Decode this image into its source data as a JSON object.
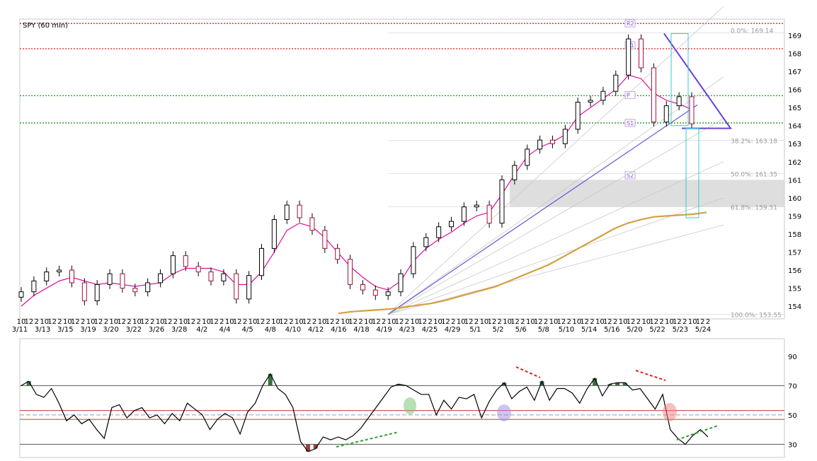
{
  "chart_data": [
    {
      "type": "candlestick",
      "title": "SPY (60 min)",
      "ylim": [
        153.3,
        169.9
      ],
      "y_ticks": [
        154,
        155,
        156,
        157,
        158,
        159,
        160,
        161,
        162,
        163,
        164,
        165,
        166,
        167,
        168,
        169
      ],
      "x_tick_labels_top": [
        "10",
        "12",
        "2",
        "10",
        "12",
        "2",
        "10",
        "12",
        "2",
        "10",
        "12",
        "2",
        "10",
        "12",
        "2",
        "10",
        "12",
        "2",
        "10",
        "12",
        "2",
        "10",
        "12",
        "2",
        "10",
        "12",
        "2",
        "10",
        "12",
        "2",
        "10",
        "12",
        "2",
        "10",
        "12",
        "2",
        "10",
        "12",
        "2",
        "10",
        "12",
        "2",
        "10",
        "12",
        "2",
        "10",
        "12",
        "2",
        "10",
        "12",
        "2",
        "10",
        "12",
        "2",
        "10",
        "12",
        "2",
        "10",
        "12",
        "2",
        "10",
        "12",
        "2",
        "10",
        "12",
        "2",
        "10",
        "12",
        "2",
        "10",
        "12",
        "2",
        "10",
        "12",
        "2",
        "10",
        "12",
        "2",
        "10",
        "12",
        "2",
        "10",
        "12",
        "2",
        "10",
        "12",
        "2",
        "10",
        "12",
        "2"
      ],
      "x_date_labels": [
        "3/11",
        "3/13",
        "3/15",
        "3/19",
        "3/20",
        "3/22",
        "3/26",
        "3/28",
        "4/2",
        "4/4",
        "4/5",
        "4/8",
        "4/10",
        "4/12",
        "4/16",
        "4/18",
        "4/19",
        "4/23",
        "4/25",
        "4/29",
        "5/1",
        "5/2",
        "5/6",
        "5/8",
        "5/10",
        "5/14",
        "5/16",
        "5/20",
        "5/22",
        "5/23",
        "5/24"
      ],
      "close_series": [
        154.8,
        155.4,
        155.9,
        156.0,
        155.3,
        154.3,
        155.2,
        155.8,
        155.0,
        154.8,
        155.3,
        155.8,
        156.8,
        156.2,
        155.9,
        155.4,
        155.8,
        154.4,
        155.7,
        157.2,
        158.8,
        159.6,
        158.9,
        158.2,
        157.2,
        156.6,
        155.2,
        154.9,
        154.6,
        154.8,
        155.8,
        157.3,
        157.8,
        158.4,
        158.7,
        159.5,
        159.6,
        158.6,
        161.0,
        161.8,
        162.7,
        163.2,
        163.0,
        163.8,
        165.3,
        165.4,
        165.9,
        166.8,
        168.8,
        167.2,
        164.2,
        165.1,
        165.6,
        164.1
      ],
      "moving_averages": [
        {
          "color": "#e0109a",
          "values": [
            154.0,
            154.6,
            155.0,
            155.4,
            155.6,
            155.4,
            155.2,
            155.3,
            155.2,
            155.1,
            155.2,
            155.3,
            155.8,
            156.1,
            156.1,
            156.1,
            155.9,
            155.2,
            155.2,
            155.9,
            157.0,
            158.2,
            158.6,
            158.4,
            157.8,
            157.0,
            156.2,
            155.6,
            155.1,
            154.9,
            155.4,
            156.5,
            157.2,
            157.7,
            158.1,
            158.6,
            159.0,
            159.2,
            160.2,
            161.3,
            162.3,
            162.8,
            163.1,
            163.5,
            164.5,
            165.0,
            165.5,
            166.0,
            166.8,
            166.6,
            165.8,
            165.4,
            165.2,
            164.9
          ]
        },
        {
          "color": "#d4a040",
          "values": [
            153.6,
            153.7,
            153.75,
            153.8,
            153.85,
            153.95,
            154.05,
            154.15,
            154.3,
            154.5,
            154.7,
            154.9,
            155.1,
            155.4,
            155.7,
            156.0,
            156.3,
            156.7,
            157.1,
            157.5,
            157.9,
            158.3,
            158.6,
            158.8,
            158.95,
            159.0,
            159.05,
            159.1,
            159.2
          ]
        }
      ],
      "horizontal_levels": [
        {
          "value": 169.66,
          "color": "#e03030"
        },
        {
          "value": 168.26,
          "color": "#e03030"
        },
        {
          "value": 165.66,
          "color": "#30a030"
        },
        {
          "value": 164.15,
          "color": "#30a030"
        }
      ],
      "pivot_labels": [
        {
          "text": "R2",
          "value": 169.66
        },
        {
          "text": "R1",
          "value": 168.45
        },
        {
          "text": "P",
          "value": 165.7
        },
        {
          "text": "S1",
          "value": 164.15
        },
        {
          "text": "S2",
          "value": 161.25
        }
      ],
      "fibonacci": [
        {
          "label": "0.0%: 169.14",
          "value": 169.14
        },
        {
          "label": "38.2%: 163.18",
          "value": 163.18
        },
        {
          "label": "50.0%: 161.35",
          "value": 161.35
        },
        {
          "label": "61.8%: 159.51",
          "value": 159.51
        },
        {
          "label": "100.0%: 153.55",
          "value": 153.55
        }
      ],
      "highlight_zone": [
        159.5,
        161.0
      ]
    },
    {
      "type": "line",
      "ylim": [
        21,
        102
      ],
      "y_ticks": [
        30,
        50,
        70,
        90
      ],
      "reference_lines": [
        30,
        47,
        50,
        53,
        70
      ],
      "values": [
        70,
        73,
        64,
        62,
        68,
        58,
        46,
        50,
        44,
        47,
        40,
        34,
        55,
        57,
        48,
        53,
        55,
        48,
        50,
        44,
        51,
        46,
        58,
        54,
        50,
        40,
        47,
        51,
        48,
        37,
        52,
        58,
        70,
        78,
        68,
        64,
        55,
        32,
        25,
        27,
        35,
        33,
        35,
        33,
        36,
        41,
        48,
        55,
        62,
        69,
        71,
        70,
        67,
        64,
        64,
        50,
        60,
        54,
        62,
        61,
        64,
        48,
        59,
        67,
        72,
        61,
        66,
        69,
        60,
        73,
        60,
        68,
        68,
        65,
        58,
        68,
        75,
        63,
        71,
        72,
        72,
        67,
        68,
        61,
        54,
        64,
        40,
        34,
        30,
        36,
        40,
        35
      ]
    }
  ]
}
